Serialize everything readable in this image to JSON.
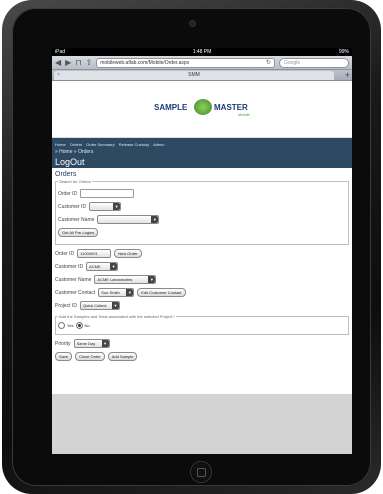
{
  "status": {
    "carrier": "iPad",
    "time": "1:48 PM",
    "battery": "99%"
  },
  "browser": {
    "url": "mobileweb.aflab.com/Mobile/Order.aspx",
    "search_placeholder": "Google",
    "tab_title": "SMM",
    "tab_close": "×",
    "new_tab": "+"
  },
  "logo": {
    "word1": "SAMPLE",
    "word2": "MASTER",
    "tagline": "Mobile"
  },
  "nav": {
    "links": [
      "Home",
      "Orders",
      "Order Summary",
      "Release Custody",
      "Admin"
    ],
    "breadcrumb": "» Home » Orders",
    "logout": "LogOut"
  },
  "page": {
    "title": "Orders"
  },
  "search": {
    "legend": "Search for Orders",
    "order_id_label": "Order ID",
    "customer_id_label": "Customer ID",
    "customer_name_label": "Customer Name",
    "get_all_button": "Get All Pre-Logins"
  },
  "form": {
    "order_id_label": "Order ID",
    "order_id_value": "11000001",
    "new_order_button": "New Order",
    "customer_id_label": "Customer ID",
    "customer_id_value": "ACME",
    "customer_name_label": "Customer Name",
    "customer_name_value": "ACME Laboratories",
    "customer_contact_label": "Customer Contact",
    "customer_contact_value": "Sue Smith",
    "edit_contact_button": "Edit Customer Contact",
    "project_id_label": "Project ID",
    "project_id_value": "Quick Collect",
    "project_legend": "Add the Samples and Tests associated with the selected Project?",
    "yes_label": "Yes",
    "no_label": "No",
    "priority_label": "Priority",
    "priority_value": "Same Day",
    "save_button": "Save",
    "close_order_button": "Close Order",
    "add_sample_button": "Add Sample"
  }
}
